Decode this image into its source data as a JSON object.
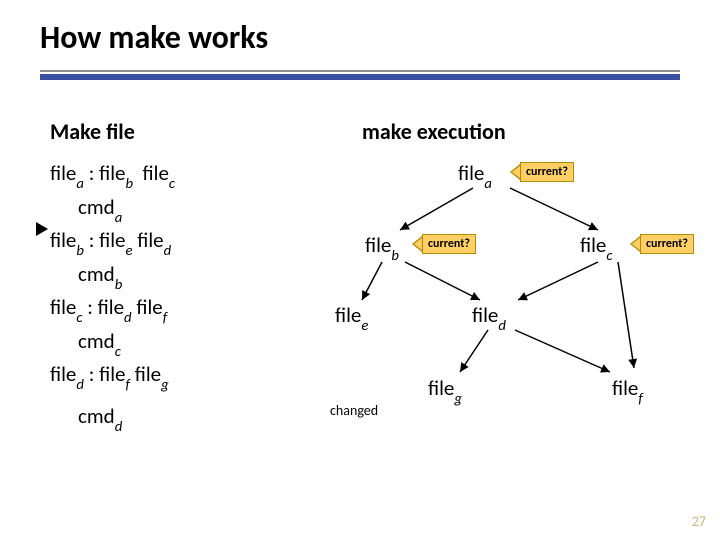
{
  "title": "How make works",
  "left_heading": "Make file",
  "right_heading": "make execution",
  "rules": [
    {
      "target": "file",
      "ts": "a",
      "d1": "file",
      "d1s": "b",
      "d2": "file",
      "d2s": "c",
      "cmd": "cmd",
      "cs": "a"
    },
    {
      "target": "file",
      "ts": "b",
      "d1": "file",
      "d1s": "e",
      "d2": "file",
      "d2s": "d",
      "cmd": "cmd",
      "cs": "b"
    },
    {
      "target": "file",
      "ts": "c",
      "d1": "file",
      "d1s": "d",
      "d2": "file",
      "d2s": "f",
      "cmd": "cmd",
      "cs": "c"
    },
    {
      "target": "file",
      "ts": "d",
      "d1": "file",
      "d1s": "f",
      "d2": "file",
      "d2s": "g",
      "cmd": "cmd",
      "cs": "d"
    }
  ],
  "nodes": {
    "a": "file",
    "as": "a",
    "b": "file",
    "bs": "b",
    "c": "file",
    "cs": "c",
    "d": "file",
    "ds": "d",
    "e": "file",
    "es": "e",
    "f": "file",
    "fs": "f",
    "g": "file",
    "gs": "g"
  },
  "labels": {
    "current": "current?",
    "changed": "changed"
  },
  "page_number": "27"
}
